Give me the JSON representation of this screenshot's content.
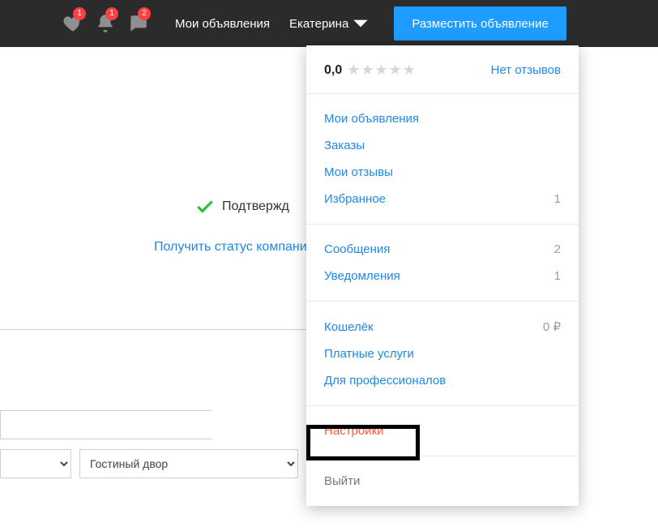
{
  "topbar": {
    "badges": {
      "favorites": "1",
      "notifications": "1",
      "messages": "2"
    },
    "my_ads": "Мои объявления",
    "user_name": "Екатерина",
    "post_button": "Разместить объявление"
  },
  "verify": {
    "label": "Подтвержд"
  },
  "company_link": "Получить статус компани",
  "form": {
    "input1_value": "",
    "select2_value": "Гостиный двор"
  },
  "dropdown": {
    "rating_value": "0,0",
    "reviews_link": "Нет отзывов",
    "section1": {
      "my_ads": "Мои объявления",
      "orders": "Заказы",
      "my_reviews": "Мои отзывы",
      "favorites": {
        "label": "Избранное",
        "count": "1"
      }
    },
    "section2": {
      "messages": {
        "label": "Сообщения",
        "count": "2"
      },
      "notifications": {
        "label": "Уведомления",
        "count": "1"
      }
    },
    "section3": {
      "wallet": {
        "label": "Кошелёк",
        "amount": "0",
        "currency": "₽"
      },
      "paid": "Платные услуги",
      "pro": "Для профессионалов"
    },
    "section4": {
      "settings": "Настройки"
    },
    "section5": {
      "logout": "Выйти"
    }
  }
}
